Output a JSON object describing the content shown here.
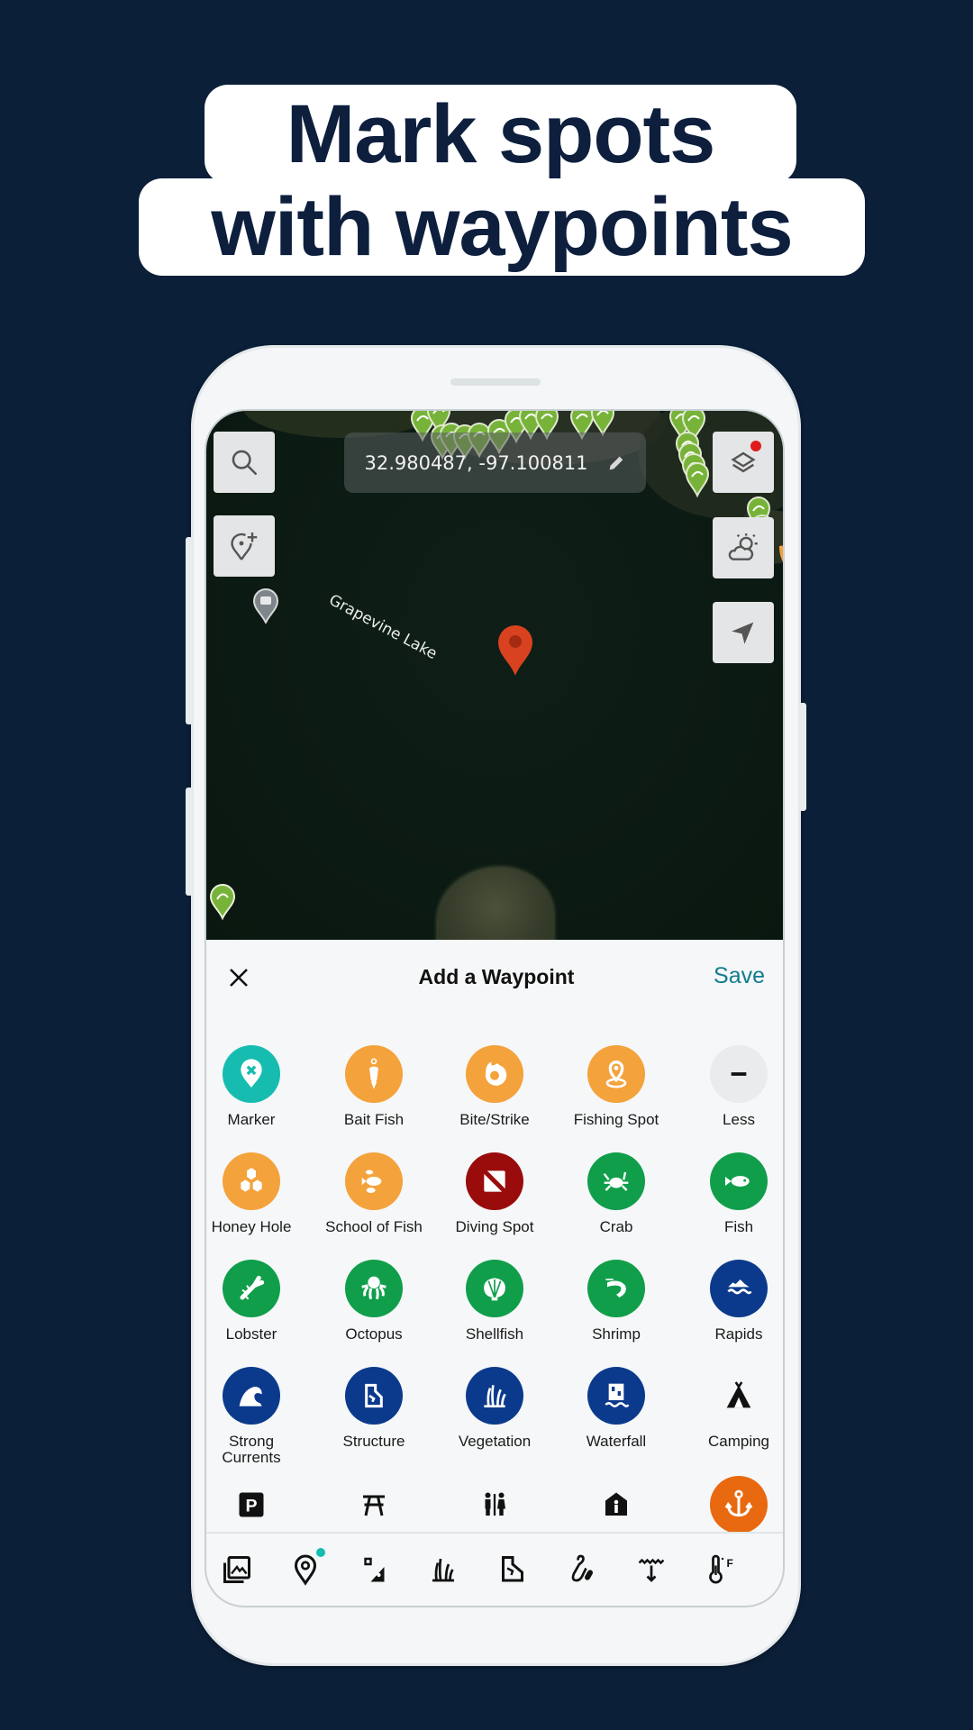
{
  "headline": {
    "line1": "Mark spots",
    "line2": "with waypoints"
  },
  "colors": {
    "background": "#0b1f38",
    "headline_text": "#0d1f3d",
    "save": "#127c8e",
    "teal": "#17bcb0",
    "orange": "#f4a23b",
    "dark_red": "#9a0c0c",
    "green": "#109e4b",
    "navy": "#0b3a8c",
    "anchor_orange": "#e8690f",
    "map_pin_green": "#78b339",
    "selected_pin_red": "#d9421f"
  },
  "map": {
    "coordinates": "32.980487, -97.100811",
    "lake_label": "Grapevine Lake",
    "buttons": {
      "search": "search-icon",
      "add_waypoint": "add-location-icon",
      "layers": "layers-icon",
      "weather": "weather-icon",
      "locate": "navigation-arrow-icon"
    }
  },
  "sheet": {
    "close_icon": "close-icon",
    "title": "Add a Waypoint",
    "save_label": "Save",
    "categories": [
      {
        "label": "Marker",
        "icon": "marker-icon",
        "color": "#17bcb0"
      },
      {
        "label": "Bait Fish",
        "icon": "bait-fish-icon",
        "color": "#f4a23b"
      },
      {
        "label": "Bite/Strike",
        "icon": "bite-strike-icon",
        "color": "#f4a23b"
      },
      {
        "label": "Fishing Spot",
        "icon": "fishing-spot-icon",
        "color": "#f4a23b"
      },
      {
        "label": "Less",
        "icon": "minus-icon",
        "color": "#e9ebec"
      },
      {
        "label": "Honey Hole",
        "icon": "honey-hole-icon",
        "color": "#f4a23b"
      },
      {
        "label": "School of Fish",
        "icon": "school-of-fish-icon",
        "color": "#f4a23b"
      },
      {
        "label": "Diving Spot",
        "icon": "diving-flag-icon",
        "color": "#9a0c0c"
      },
      {
        "label": "Crab",
        "icon": "crab-icon",
        "color": "#109e4b"
      },
      {
        "label": "Fish",
        "icon": "fish-icon",
        "color": "#109e4b"
      },
      {
        "label": "Lobster",
        "icon": "lobster-icon",
        "color": "#109e4b"
      },
      {
        "label": "Octopus",
        "icon": "octopus-icon",
        "color": "#109e4b"
      },
      {
        "label": "Shellfish",
        "icon": "shell-icon",
        "color": "#109e4b"
      },
      {
        "label": "Shrimp",
        "icon": "shrimp-icon",
        "color": "#109e4b"
      },
      {
        "label": "Rapids",
        "icon": "rapids-icon",
        "color": "#0b3a8c"
      },
      {
        "label": "Strong Currents",
        "icon": "wave-icon",
        "color": "#0b3a8c"
      },
      {
        "label": "Structure",
        "icon": "structure-icon",
        "color": "#0b3a8c"
      },
      {
        "label": "Vegetation",
        "icon": "vegetation-icon",
        "color": "#0b3a8c"
      },
      {
        "label": "Waterfall",
        "icon": "waterfall-icon",
        "color": "#0b3a8c"
      },
      {
        "label": "Camping",
        "icon": "tent-icon",
        "color": "transparent"
      }
    ],
    "amenities": [
      {
        "icon": "parking-icon"
      },
      {
        "icon": "picnic-table-icon"
      },
      {
        "icon": "restroom-icon"
      },
      {
        "icon": "shelter-icon"
      },
      {
        "icon": "anchor-icon",
        "color": "#e8690f"
      }
    ],
    "toolbar": [
      {
        "icon": "photos-icon"
      },
      {
        "icon": "location-pin-icon",
        "badge": true
      },
      {
        "icon": "bottom-type-icon"
      },
      {
        "icon": "vegetation-outline-icon"
      },
      {
        "icon": "structure-outline-icon"
      },
      {
        "icon": "lure-icon"
      },
      {
        "icon": "depth-icon"
      },
      {
        "icon": "temperature-icon",
        "unit": "F"
      }
    ]
  }
}
